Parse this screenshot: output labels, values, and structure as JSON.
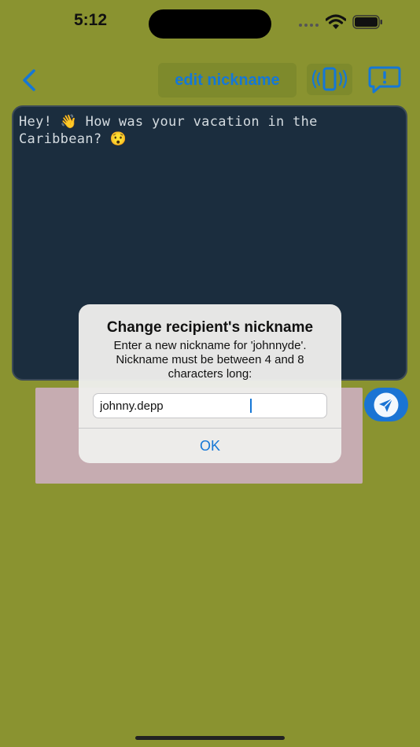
{
  "status_bar": {
    "time": "5:12",
    "wifi_icon": "wifi-icon",
    "battery_icon": "battery-icon"
  },
  "nav": {
    "back_icon": "chevron-left-icon",
    "edit_nickname_label": "edit nickname",
    "vibrate_icon": "phone-vibrate-icon",
    "report_icon": "exclamation-bubble-icon"
  },
  "message": {
    "text": "Hey! 👋 How was your vacation in the\nCaribbean? 😯"
  },
  "compose": {
    "send_icon": "paper-plane-icon"
  },
  "alert": {
    "title": "Change recipient's nickname",
    "message": "Enter a new nickname for 'johnnyde'. Nickname must be between 4 and 8 characters long:",
    "input_value": "johnny.depp",
    "ok_label": "OK"
  },
  "colors": {
    "background": "#8a9330",
    "accent": "#1577d6",
    "message_panel": "#1b2d3e",
    "compose_box": "#c6acb1"
  }
}
